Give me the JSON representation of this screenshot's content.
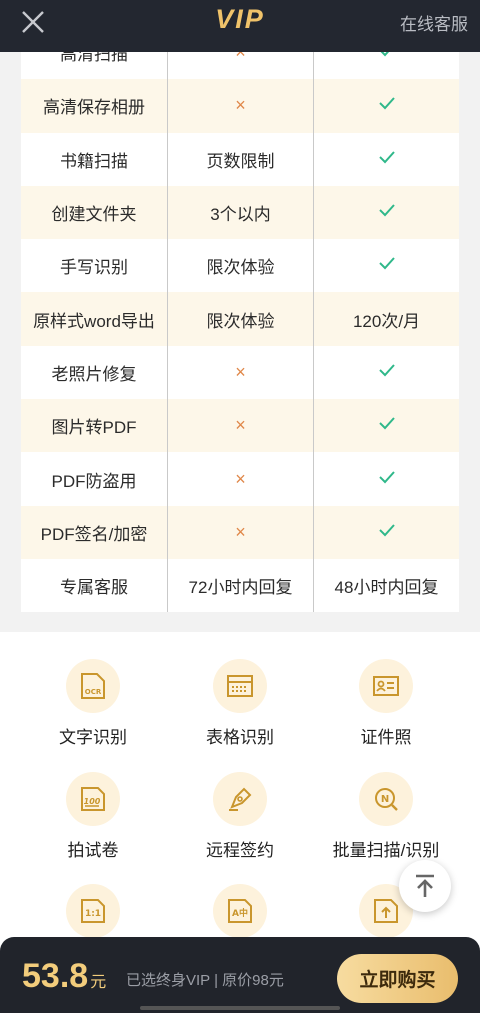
{
  "header": {
    "title": "VIP",
    "service": "在线客服"
  },
  "table": {
    "rows": [
      {
        "name": "高清扫描",
        "free": "×",
        "vip": "check"
      },
      {
        "name": "高清保存相册",
        "free": "×",
        "vip": "check"
      },
      {
        "name": "书籍扫描",
        "free": "页数限制",
        "vip": "check"
      },
      {
        "name": "创建文件夹",
        "free": "3个以内",
        "vip": "check"
      },
      {
        "name": "手写识别",
        "free": "限次体验",
        "vip": "check"
      },
      {
        "name": "原样式word导出",
        "free": "限次体验",
        "vip": "120次/月"
      },
      {
        "name": "老照片修复",
        "free": "×",
        "vip": "check"
      },
      {
        "name": "图片转PDF",
        "free": "×",
        "vip": "check"
      },
      {
        "name": "PDF防盗用",
        "free": "×",
        "vip": "check"
      },
      {
        "name": "PDF签名/加密",
        "free": "×",
        "vip": "check"
      },
      {
        "name": "专属客服",
        "free": "72小时内回复",
        "vip": "48小时内回复"
      }
    ]
  },
  "features": {
    "items": [
      {
        "label": "文字识别",
        "icon": "ocr-icon"
      },
      {
        "label": "表格识别",
        "icon": "table-icon"
      },
      {
        "label": "证件照",
        "icon": "id-photo-icon"
      },
      {
        "label": "拍试卷",
        "icon": "exam-icon"
      },
      {
        "label": "远程签约",
        "icon": "pen-icon"
      },
      {
        "label": "批量扫描/识别",
        "icon": "batch-scan-icon"
      },
      {
        "label": "",
        "icon": "ratio-icon"
      },
      {
        "label": "",
        "icon": "translate-icon"
      },
      {
        "label": "",
        "icon": "upload-icon"
      }
    ],
    "icon_glyphs": {
      "ocr": "OCR",
      "exam": "100",
      "ratio": "1:1",
      "translate": "A中"
    }
  },
  "bottom": {
    "price": "53.8",
    "unit": "元",
    "desc": "已选终身VIP  |  原价98元",
    "buy": "立即购买"
  },
  "colors": {
    "accent": "#f0c36a",
    "dark": "#21242b",
    "check": "#2fb88a",
    "cross": "#e0884a"
  }
}
